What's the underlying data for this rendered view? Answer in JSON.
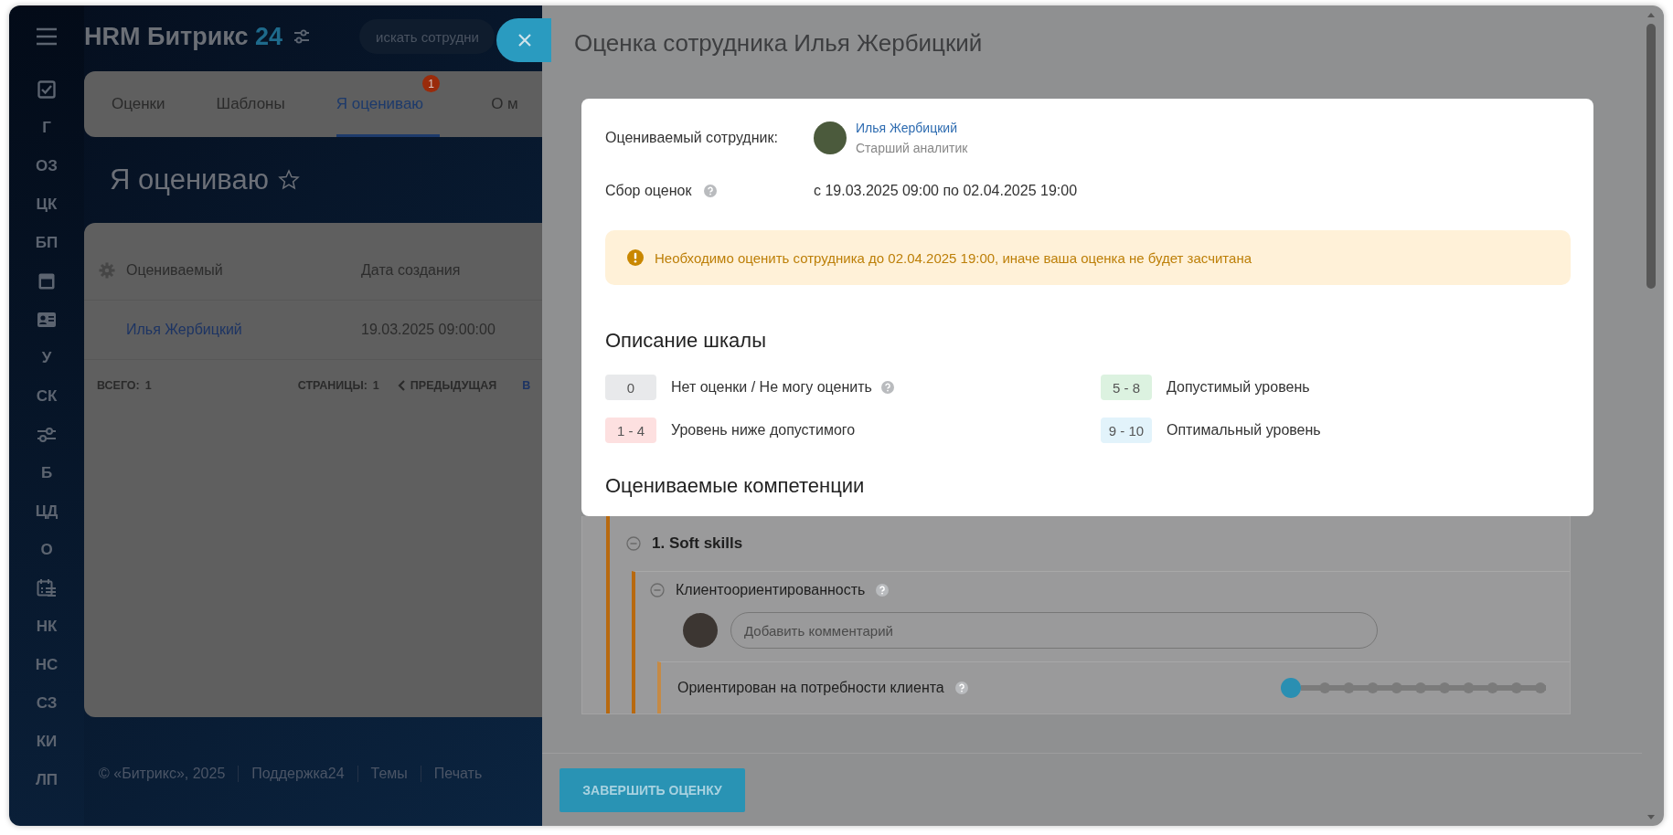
{
  "sidebar": {
    "items": [
      {
        "kind": "checklist"
      },
      {
        "kind": "text",
        "label": "Г"
      },
      {
        "kind": "text",
        "label": "ОЗ"
      },
      {
        "kind": "text",
        "label": "ЦК"
      },
      {
        "kind": "text",
        "label": "БП"
      },
      {
        "kind": "window"
      },
      {
        "kind": "contact"
      },
      {
        "kind": "text",
        "label": "У"
      },
      {
        "kind": "text",
        "label": "СК"
      },
      {
        "kind": "sliders"
      },
      {
        "kind": "text",
        "label": "Б"
      },
      {
        "kind": "text",
        "label": "ЦД"
      },
      {
        "kind": "text",
        "label": "О"
      },
      {
        "kind": "calendar"
      },
      {
        "kind": "text",
        "label": "НК"
      },
      {
        "kind": "text",
        "label": "НС"
      },
      {
        "kind": "text",
        "label": "СЗ"
      },
      {
        "kind": "text",
        "label": "КИ"
      },
      {
        "kind": "text",
        "label": "ЛП"
      }
    ]
  },
  "header": {
    "logo": "HRM Битрикс",
    "logo_accent": "24",
    "search": {
      "placeholder": "искать сотрудни"
    }
  },
  "tabs": [
    {
      "label": "Оценки",
      "selected": false
    },
    {
      "label": "Шаблоны",
      "selected": false
    },
    {
      "label": "Я оцениваю",
      "selected": true,
      "badge": "1"
    },
    {
      "label": "О м",
      "selected": false
    }
  ],
  "page_title": "Я оцениваю",
  "favorite": false,
  "table": {
    "columns": [
      "Оцениваемый",
      "Дата создания"
    ],
    "rows": [
      [
        "Илья Жербицкий",
        "19.03.2025 09:00:00"
      ]
    ],
    "footer": {
      "total_label": "ВСЕГО:",
      "total": "1",
      "pages_label": "СТРАНИЦЫ:",
      "pages": "1",
      "prev": "ПРЕДЫДУЩАЯ",
      "next": "В"
    }
  },
  "footer": {
    "links": [
      "© «Битрикс», 2025",
      "Поддержка24",
      "Темы",
      "Печать"
    ]
  },
  "panel": {
    "title": "Оценка сотрудника Илья Жербицкий",
    "employee": {
      "label": "Оцениваемый сотрудник:",
      "name": "Илья Жербицкий",
      "position": "Старший аналитик"
    },
    "period": {
      "label": "Сбор оценок",
      "help": true,
      "value": "с 19.03.2025 09:00 по 02.04.2025 19:00"
    },
    "alert": "Необходимо оценить сотрудника до 02.04.2025 19:00, иначе ваша оценка не будет засчитана",
    "scale": {
      "title": "Описание шкалы",
      "items": [
        {
          "range": "0",
          "label": "Нет оценки / Не могу оценить",
          "help": true,
          "color": "#e8e9eb"
        },
        {
          "range": "5 - 8",
          "label": "Допустимый уровень",
          "help": false,
          "color": "#dcf2e0"
        },
        {
          "range": "1 - 4",
          "label": "Уровень ниже допустимого",
          "help": false,
          "color": "#fde0e0"
        },
        {
          "range": "9 - 10",
          "label": "Оптимальный уровень",
          "help": false,
          "color": "#e2f3fb"
        }
      ]
    },
    "competencies": {
      "title": "Оцениваемые компетенции",
      "groups": [
        {
          "title": "1. Soft skills",
          "expanded": true,
          "help": false,
          "children": [
            {
              "title": "Клиентоориентированность",
              "expanded": true,
              "help": true,
              "comment_placeholder": "Добавить комментарий",
              "children": [
                {
                  "title": "Ориентирован на потребности клиента",
                  "help": true,
                  "level": 0
                }
              ]
            }
          ]
        }
      ]
    },
    "submit_button": "ЗАВЕРШИТЬ ОЦЕНКУ"
  }
}
